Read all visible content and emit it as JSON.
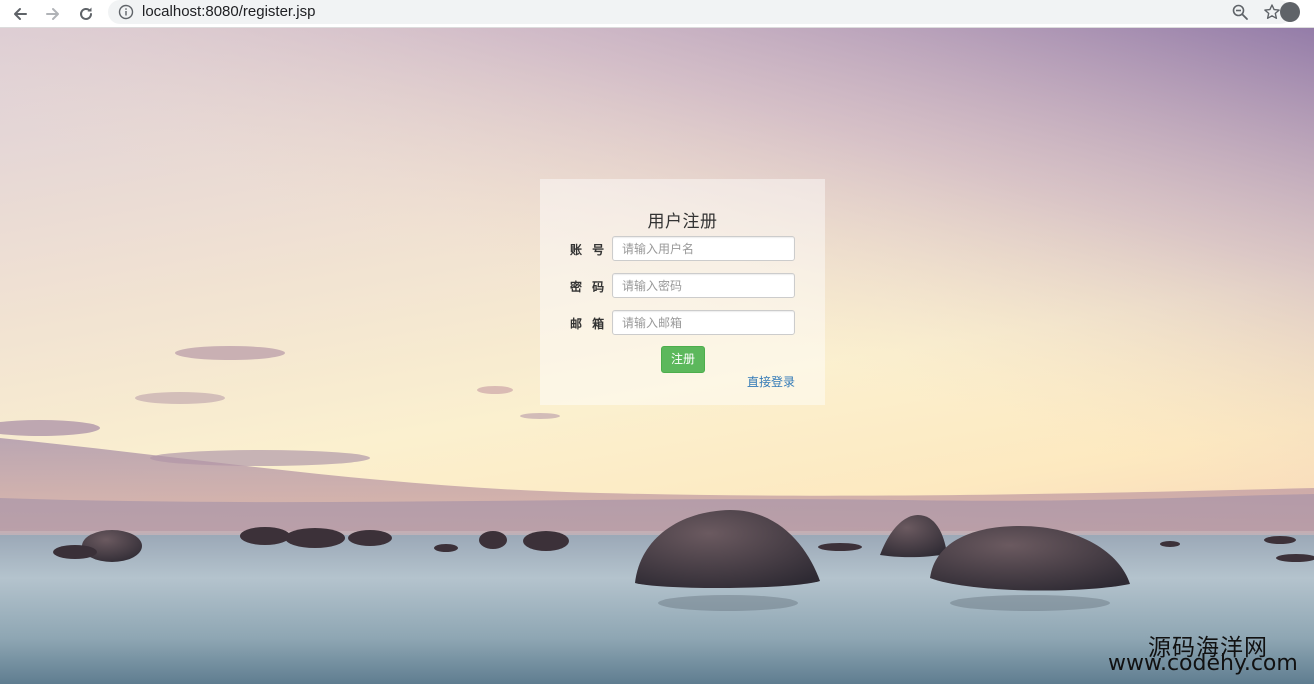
{
  "browser": {
    "url": "localhost:8080/register.jsp",
    "icons": {
      "back": "back-arrow-icon",
      "forward": "forward-arrow-icon",
      "reload": "reload-icon",
      "info": "info-icon",
      "zoom": "zoom-out-icon",
      "bookmark": "star-icon",
      "profile": "profile-icon"
    }
  },
  "form": {
    "title": "用户注册",
    "fields": [
      {
        "label": "账 号",
        "placeholder": "请输入用户名",
        "value": ""
      },
      {
        "label": "密 码",
        "placeholder": "请输入密码",
        "value": ""
      },
      {
        "label": "邮 箱",
        "placeholder": "请输入邮箱",
        "value": ""
      }
    ],
    "submit_label": "注册",
    "login_link": "直接登录"
  },
  "watermark": {
    "name": "源码海洋网",
    "url": "www.codehy.com"
  },
  "colors": {
    "submit_bg": "#5cb85c",
    "link": "#337ab7"
  }
}
